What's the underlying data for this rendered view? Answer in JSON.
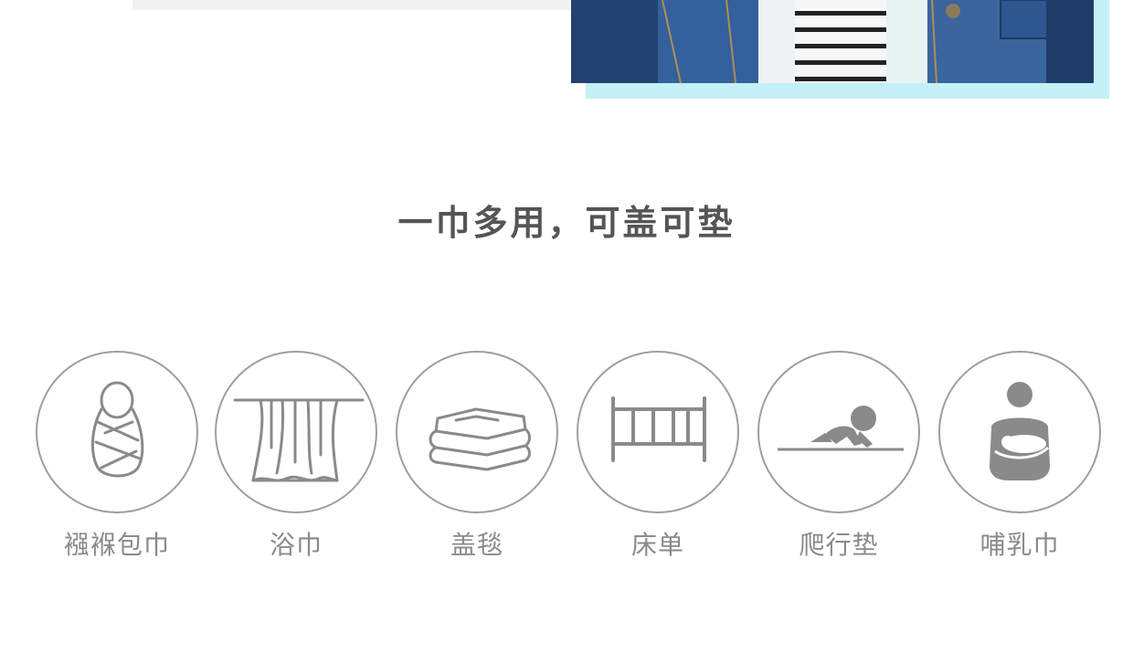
{
  "section_title": "一巾多用，可盖可垫",
  "uses": [
    {
      "icon": "swaddle-baby-icon",
      "label": "襁褓包巾"
    },
    {
      "icon": "curtain-towel-icon",
      "label": "浴巾"
    },
    {
      "icon": "folded-blanket-icon",
      "label": "盖毯"
    },
    {
      "icon": "crib-icon",
      "label": "床单"
    },
    {
      "icon": "crawling-baby-icon",
      "label": "爬行垫"
    },
    {
      "icon": "nursing-mother-icon",
      "label": "哺乳巾"
    }
  ],
  "colors": {
    "title": "#555555",
    "label": "#8a8a8a",
    "icon_stroke": "#9e9e9e",
    "frame_accent": "#c3f1f7"
  }
}
